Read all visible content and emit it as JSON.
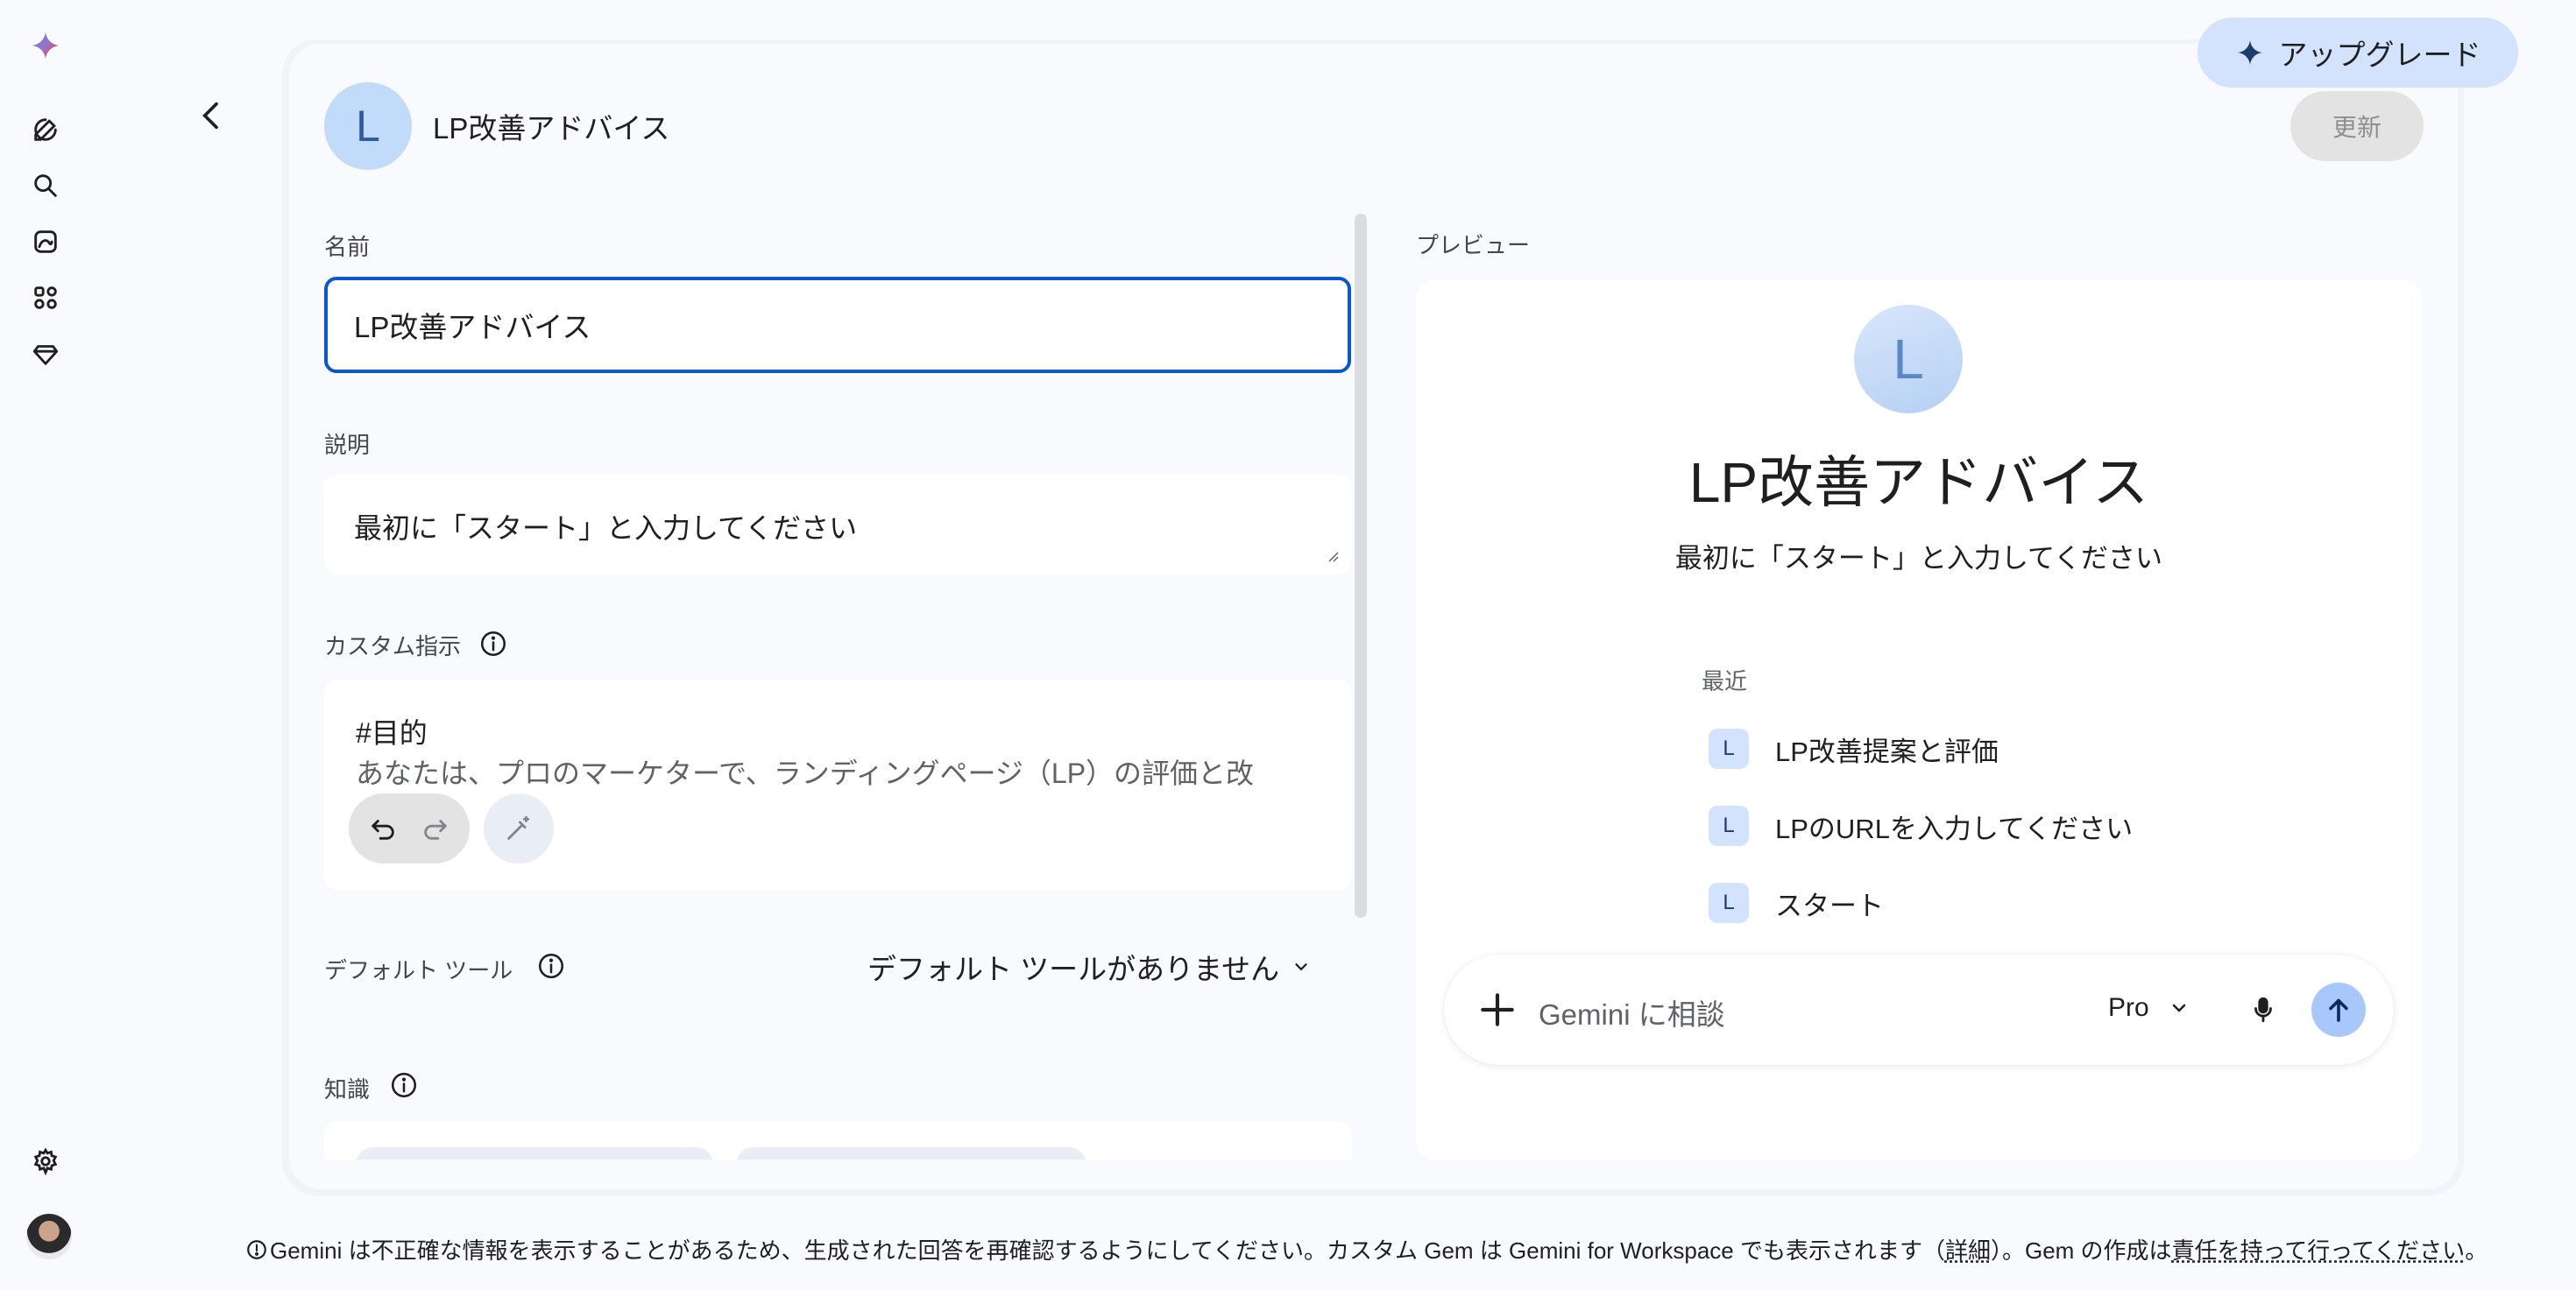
{
  "header": {
    "gem_initial": "L",
    "gem_title": "LP改善アドバイス",
    "upgrade_label": "アップグレード",
    "update_label": "更新"
  },
  "form": {
    "name_label": "名前",
    "name_value": "LP改善アドバイス",
    "description_label": "説明",
    "description_value": "最初に「スタート」と入力してください",
    "instructions_label": "カスタム指示",
    "instructions_line1": "#目的",
    "instructions_line2": "あなたは、プロのマーケターで、ランディングページ（LP）の評価と改",
    "default_tools_label": "デフォルト ツール",
    "default_tools_value": "デフォルト ツールがありません",
    "knowledge_label": "知識"
  },
  "preview": {
    "label": "プレビュー",
    "avatar_initial": "L",
    "title": "LP改善アドバイス",
    "description": "最初に「スタート」と入力してください",
    "recent_label": "最近",
    "recent_items": [
      {
        "badge": "L",
        "label": "LP改善提案と評価"
      },
      {
        "badge": "L",
        "label": "LPのURLを入力してください"
      },
      {
        "badge": "L",
        "label": "スタート"
      }
    ],
    "chat_placeholder": "Gemini に相談",
    "model": "Pro"
  },
  "footer": {
    "text_1": "Gemini は不正確な情報を表示することがあるため、生成された回答を再確認するようにしてください。カスタム Gem は Gemini for Workspace でも表示されます（",
    "link_details": "詳細",
    "text_2": "）。Gem の作成は",
    "link_responsibility": "責任を持って行ってください",
    "text_3": "。"
  },
  "icons": {
    "rail": [
      "gemini-logo-icon",
      "new-chat-icon",
      "search-icon",
      "image-gallery-icon",
      "apps-icon",
      "gem-icon",
      "settings-icon"
    ],
    "accent": "#0b57d0"
  }
}
